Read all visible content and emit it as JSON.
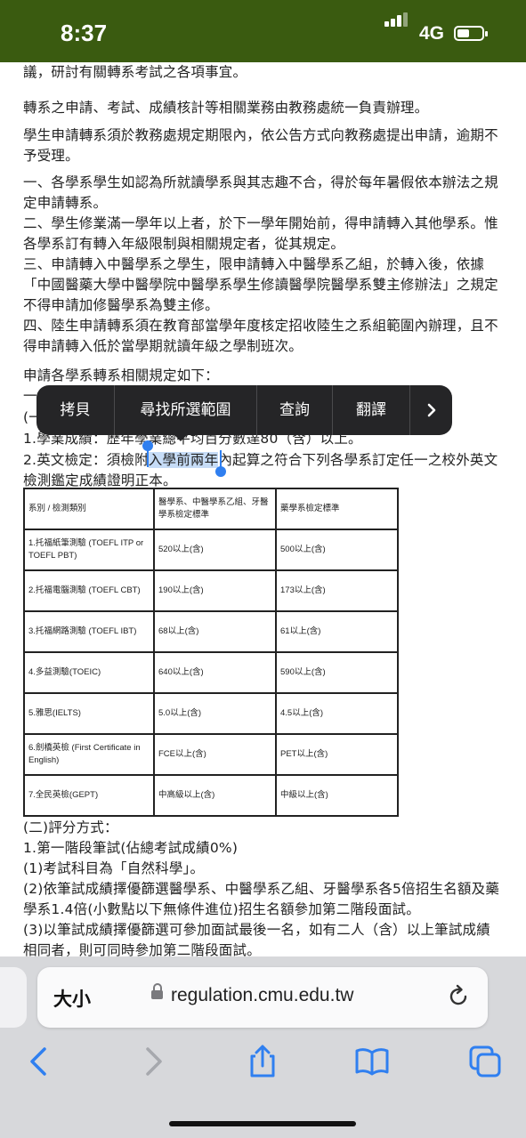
{
  "status": {
    "time": "8:37",
    "network": "4G"
  },
  "content": {
    "p0": "議，研討有關轉系考試之各項事宜。",
    "p1": "轉系之申請、考試、成績核計等相關業務由教務處統一負責辦理。",
    "p2a": "學生申請轉系須於教務處規定期限內，依公告方式向教務處提出申請，逾期不",
    "p2b": "予受理。",
    "p3a": "一、各學系學生如認為所就讀學系與其志趣不合，得於每年暑假依本辦法之規",
    "p3b": "定申請轉系。",
    "p4a": "二、學生修業滿一學年以上者，於下一學年開始前，得申請轉入其他學系。惟",
    "p4b": "各學系訂有轉入年級限制與相關規定者，從其規定。",
    "p5a": "三、申請轉入中醫學系之學生，限申請轉入中醫學系乙組，於轉入後，依據",
    "p5b": "「中國醫藥大學中醫學院中醫學系學生修讀醫學院醫學系雙主修辦法」之規定",
    "p5c": "不得申請加修醫學系為雙主修。",
    "p6a": "四、陸生申請轉系須在教育部當學年度核定招收陸生之系組範圍內辦理，且不",
    "p6b": "得申請轉入低於當學期就讀年級之學制班次。",
    "p7": "申請各學系轉系相關規定如下：",
    "p8": "一",
    "p9": "(一",
    "p10": "1.學業成績：歷年學業總平均百分數達80（含）以上。",
    "p11a_pre": "2.英文檢定：須檢附",
    "p11a_sel": "入學前兩年",
    "p11a_post": "內起算之符合下列各學系訂定任一之校外英文",
    "p11b": "檢測鑑定成績證明正本。",
    "table": {
      "header": [
        "系別 / 檢測類別",
        "醫學系、中醫學系乙組、牙醫學系檢定標準",
        "藥學系檢定標準"
      ],
      "rows": [
        [
          "1.托福紙筆測驗 (TOEFL ITP or TOEFL PBT)",
          "520以上(含)",
          "500以上(含)"
        ],
        [
          "2.托福電腦測驗 (TOEFL CBT)",
          "190以上(含)",
          "173以上(含)"
        ],
        [
          "3.托福網路測驗 (TOEFL IBT)",
          "68以上(含)",
          "61以上(含)"
        ],
        [
          "4.多益測驗(TOEIC)",
          "640以上(含)",
          "590以上(含)"
        ],
        [
          "5.雅思(IELTS)",
          "5.0以上(含)",
          "4.5以上(含)"
        ],
        [
          "6.劍橋英檢 (First Certificate in English)",
          "FCE以上(含)",
          "PET以上(含)"
        ],
        [
          "7.全民英檢(GEPT)",
          "中高級以上(含)",
          "中級以上(含)"
        ]
      ]
    },
    "p12": "(二)評分方式：",
    "p13": "1.第一階段筆試(佔總考試成績0%)",
    "p14": "(1)考試科目為「自然科學」。",
    "p15a": "(2)依筆試成績擇優篩選醫學系、中醫學系乙組、牙醫學系各5倍招生名額及藥",
    "p15b": "學系1.4倍(小數點以下無條件進位)招生名額參加第二階段面試。",
    "p16a": "(3)以筆試成績擇優篩選可參加面試最後一名，如有二人（含）以上筆試成績",
    "p16b": "相同者，則可同時參加第二階段面試。"
  },
  "menu": {
    "copy": "拷貝",
    "find": "尋找所選範圍",
    "lookup": "查詢",
    "translate": "翻譯",
    "more_icon": "chevron-right-icon"
  },
  "browser": {
    "text_size": "大小",
    "url": "regulation.cmu.edu.tw"
  },
  "colors": {
    "status_bg": "#3a5b10",
    "selection": "#c6dcf7",
    "accent": "#2f7ff0"
  }
}
